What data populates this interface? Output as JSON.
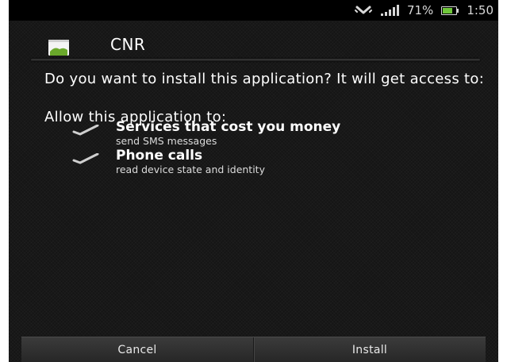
{
  "status_bar": {
    "battery_percent": "71%",
    "time": "1:50",
    "icons": [
      "vibrate-icon",
      "signal-icon",
      "battery-icon"
    ]
  },
  "dialog": {
    "app_name": "CNR",
    "question": "Do you want to install this application? It will get access to:",
    "allow_label": "Allow this application to:",
    "permissions": [
      {
        "title": "Services that cost you money",
        "detail": "send SMS messages"
      },
      {
        "title": "Phone calls",
        "detail": "read device state and identity"
      }
    ]
  },
  "buttons": {
    "cancel_label": "Cancel",
    "install_label": "Install"
  },
  "colors": {
    "background": "#151515",
    "text": "#ffffff",
    "battery_fill": "#6fc63a",
    "app_icon_accent": "#6aa82b"
  }
}
